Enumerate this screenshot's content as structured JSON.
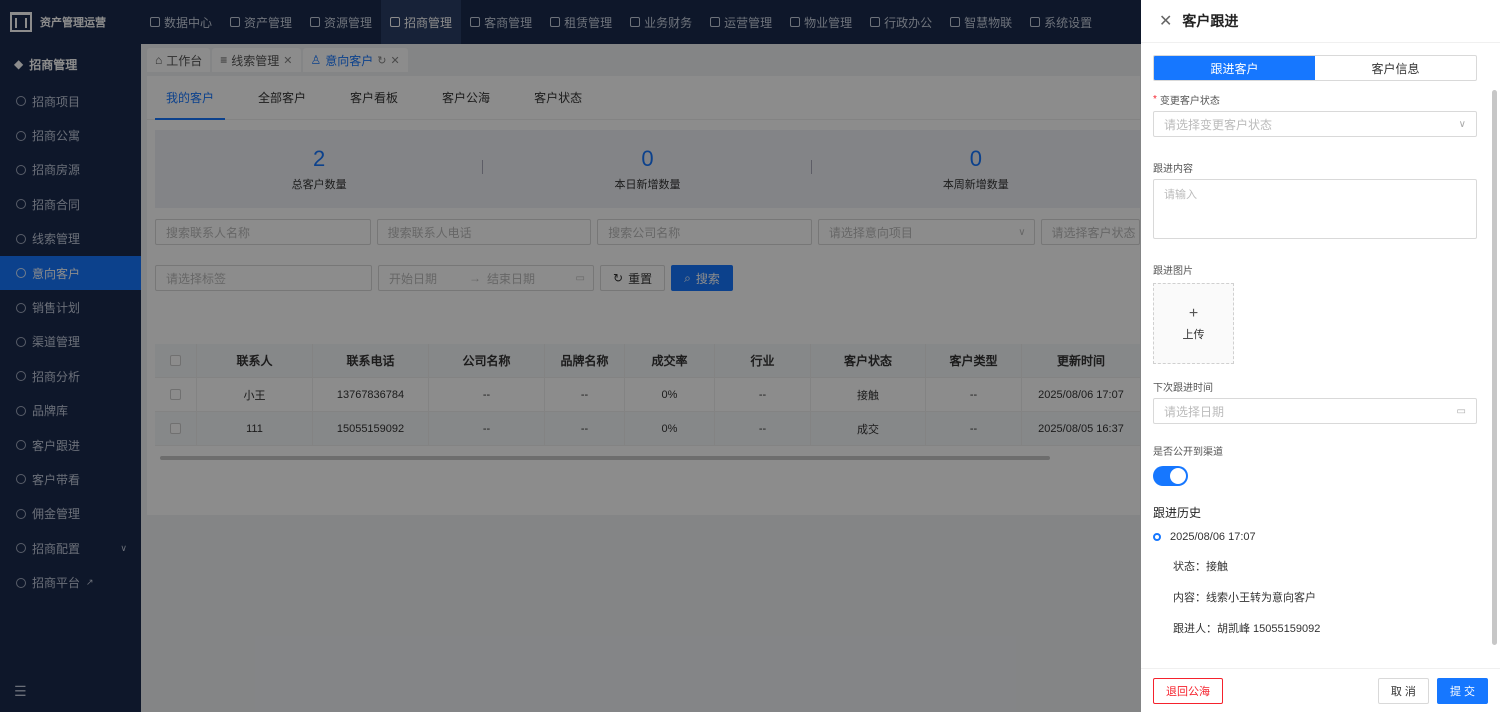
{
  "topbar": {
    "app_name": "资产管理运营",
    "nav": [
      {
        "label": "数据中心",
        "icon": "dashboard-icon"
      },
      {
        "label": "资产管理",
        "icon": "box-icon"
      },
      {
        "label": "资源管理",
        "icon": "building-icon"
      },
      {
        "label": "招商管理",
        "icon": "tag-icon"
      },
      {
        "label": "客商管理",
        "icon": "people-icon"
      },
      {
        "label": "租赁管理",
        "icon": "house-icon"
      },
      {
        "label": "业务财务",
        "icon": "money-icon"
      },
      {
        "label": "运营管理",
        "icon": "chart-icon"
      },
      {
        "label": "物业管理",
        "icon": "home-icon"
      },
      {
        "label": "行政办公",
        "icon": "monitor-icon"
      },
      {
        "label": "智慧物联",
        "icon": "network-icon"
      },
      {
        "label": "系统设置",
        "icon": "gear-icon"
      }
    ]
  },
  "sidebar": {
    "heading": "招商管理",
    "items": [
      {
        "label": "招商项目"
      },
      {
        "label": "招商公寓"
      },
      {
        "label": "招商房源"
      },
      {
        "label": "招商合同"
      },
      {
        "label": "线索管理"
      },
      {
        "label": "意向客户"
      },
      {
        "label": "销售计划"
      },
      {
        "label": "渠道管理"
      },
      {
        "label": "招商分析"
      },
      {
        "label": "品牌库"
      },
      {
        "label": "客户跟进"
      },
      {
        "label": "客户带看"
      },
      {
        "label": "佣金管理"
      },
      {
        "label": "招商配置"
      },
      {
        "label": "招商平台"
      }
    ]
  },
  "tabs": [
    {
      "label": "工作台"
    },
    {
      "label": "线索管理"
    },
    {
      "label": "意向客户"
    }
  ],
  "subtabs": [
    "我的客户",
    "全部客户",
    "客户看板",
    "客户公海",
    "客户状态"
  ],
  "stats": [
    {
      "value": "2",
      "label": "总客户数量"
    },
    {
      "value": "0",
      "label": "本日新增数量"
    },
    {
      "value": "0",
      "label": "本周新增数量"
    }
  ],
  "filters": {
    "contact_name": "搜索联系人名称",
    "contact_phone": "搜索联系人电话",
    "company_name": "搜索公司名称",
    "project": "请选择意向项目",
    "status": "请选择客户状态",
    "tag": "请选择标签",
    "start_date": "开始日期",
    "date_arrow": "→",
    "end_date": "结束日期",
    "reset": "重置",
    "search": "搜索"
  },
  "table": {
    "columns": [
      "联系人",
      "联系电话",
      "公司名称",
      "品牌名称",
      "成交率",
      "行业",
      "客户状态",
      "客户类型",
      "更新时间"
    ],
    "rows": [
      [
        "小王",
        "13767836784",
        "--",
        "--",
        "0%",
        "--",
        "接触",
        "--",
        "2025/08/06 17:07"
      ],
      [
        "111",
        "15055159092",
        "--",
        "--",
        "0%",
        "--",
        "成交",
        "--",
        "2025/08/05 16:37"
      ]
    ]
  },
  "drawer": {
    "title": "客户跟进",
    "seg": [
      "跟进客户",
      "客户信息"
    ],
    "status_label": "变更客户状态",
    "status_placeholder": "请选择变更客户状态",
    "content_label": "跟进内容",
    "content_placeholder": "请输入",
    "image_label": "跟进图片",
    "upload_plus": "+",
    "upload_text": "上传",
    "next_label": "下次跟进时间",
    "next_placeholder": "请选择日期",
    "public_label": "是否公开到渠道",
    "public_on": true,
    "history_title": "跟进历史",
    "history": {
      "time": "2025/08/06 17:07",
      "status": "状态：接触",
      "content": "内容：线索小王转为意向客户",
      "person": "跟进人：胡凯峰 15055159092"
    },
    "return_btn": "退回公海",
    "cancel_btn": "取 消",
    "submit_btn": "提 交"
  },
  "colors": {
    "primary": "#1677ff",
    "nav_bg": "#1a2b4d",
    "danger": "#f5222d"
  }
}
